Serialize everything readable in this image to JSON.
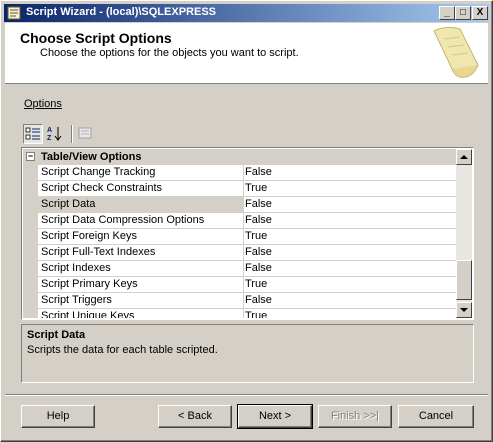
{
  "window": {
    "title": "Script Wizard - (local)\\SQLEXPRESS",
    "controls": {
      "minimize": "_",
      "maximize": "□",
      "close": "X"
    }
  },
  "header": {
    "title": "Choose Script Options",
    "subtitle": "Choose the options for the objects you want to script."
  },
  "options_label": "Options",
  "toolbar": {
    "buttons": [
      "categorized-icon",
      "alphabetical-icon",
      "property-pages-icon"
    ]
  },
  "grid": {
    "category": {
      "toggle": "−",
      "label": "Table/View Options"
    },
    "rows": [
      {
        "name": "Script Change Tracking",
        "value": "False"
      },
      {
        "name": "Script Check Constraints",
        "value": "True"
      },
      {
        "name": "Script Data",
        "value": "False"
      },
      {
        "name": "Script Data Compression Options",
        "value": "False"
      },
      {
        "name": "Script Foreign Keys",
        "value": "True"
      },
      {
        "name": "Script Full-Text Indexes",
        "value": "False"
      },
      {
        "name": "Script Indexes",
        "value": "False"
      },
      {
        "name": "Script Primary Keys",
        "value": "True"
      },
      {
        "name": "Script Triggers",
        "value": "False"
      },
      {
        "name": "Script Unique Keys",
        "value": "True"
      }
    ],
    "selected_row": "Script Data"
  },
  "description": {
    "title": "Script Data",
    "text": "Scripts the data for each table scripted."
  },
  "buttons": {
    "help": "Help",
    "back": "< Back",
    "next": "Next >",
    "finish": "Finish >>|",
    "cancel": "Cancel"
  }
}
